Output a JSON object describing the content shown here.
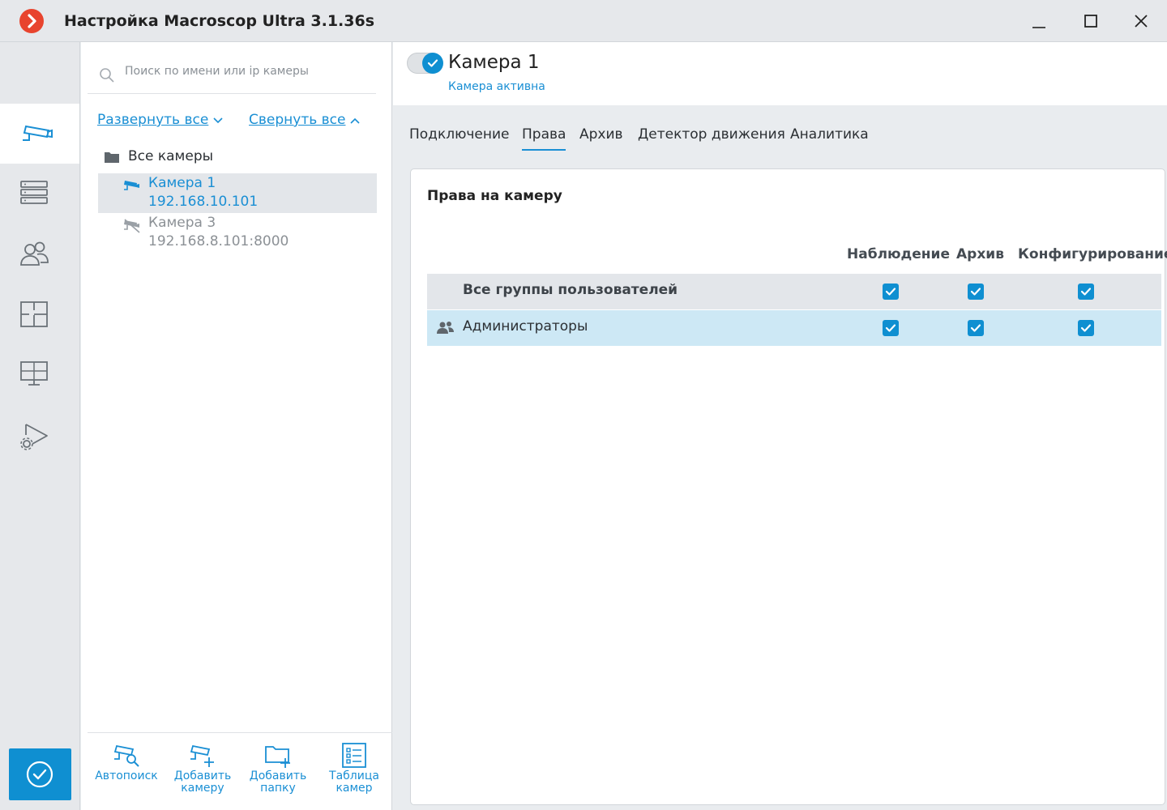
{
  "window": {
    "title": "Настройка Macroscop Ultra 3.1.36s",
    "controls": [
      "minimize",
      "maximize",
      "close"
    ]
  },
  "rail": {
    "items": [
      {
        "icon": "camera-icon",
        "active": true
      },
      {
        "icon": "server-icon",
        "active": false
      },
      {
        "icon": "users-icon",
        "active": false
      },
      {
        "icon": "floor-plan-icon",
        "active": false
      },
      {
        "icon": "monitor-grid-icon",
        "active": false
      },
      {
        "icon": "play-settings-icon",
        "active": false
      }
    ],
    "apply_icon": "check-circle-icon"
  },
  "camera_list": {
    "search_placeholder": "Поиск по имени или ip камеры",
    "expand_all": "Развернуть все",
    "collapse_all": "Свернуть все",
    "root_folder": "Все камеры",
    "cameras": [
      {
        "name": "Камера 1",
        "ip": "192.168.10.101",
        "selected": true,
        "enabled": true
      },
      {
        "name": "Камера 3",
        "ip": "192.168.8.101:8000",
        "selected": false,
        "enabled": false
      }
    ],
    "tools": [
      {
        "label_line1": "Автопоиск",
        "label_line2": ""
      },
      {
        "label_line1": "Добавить",
        "label_line2": "камеру"
      },
      {
        "label_line1": "Добавить",
        "label_line2": "папку"
      },
      {
        "label_line1": "Таблица",
        "label_line2": "камер"
      }
    ]
  },
  "camera_header": {
    "name": "Камера 1",
    "status": "Камера активна",
    "active": true
  },
  "tabs": [
    "Подключение",
    "Права",
    "Архив",
    "Детектор движения",
    "Аналитика"
  ],
  "active_tab": "Права",
  "permissions": {
    "title": "Права на камеру",
    "columns": [
      "Наблюдение",
      "Архив",
      "Конфигурирование"
    ],
    "rows": [
      {
        "label": "Все группы пользователей",
        "view": true,
        "archive": true,
        "config": true
      },
      {
        "label": "Администраторы",
        "view": true,
        "archive": true,
        "config": true
      }
    ]
  },
  "colors": {
    "accent": "#0f8fd1",
    "link": "#1a8fd4",
    "brand": "#e8442e",
    "selected_row": "#cde8f5"
  }
}
